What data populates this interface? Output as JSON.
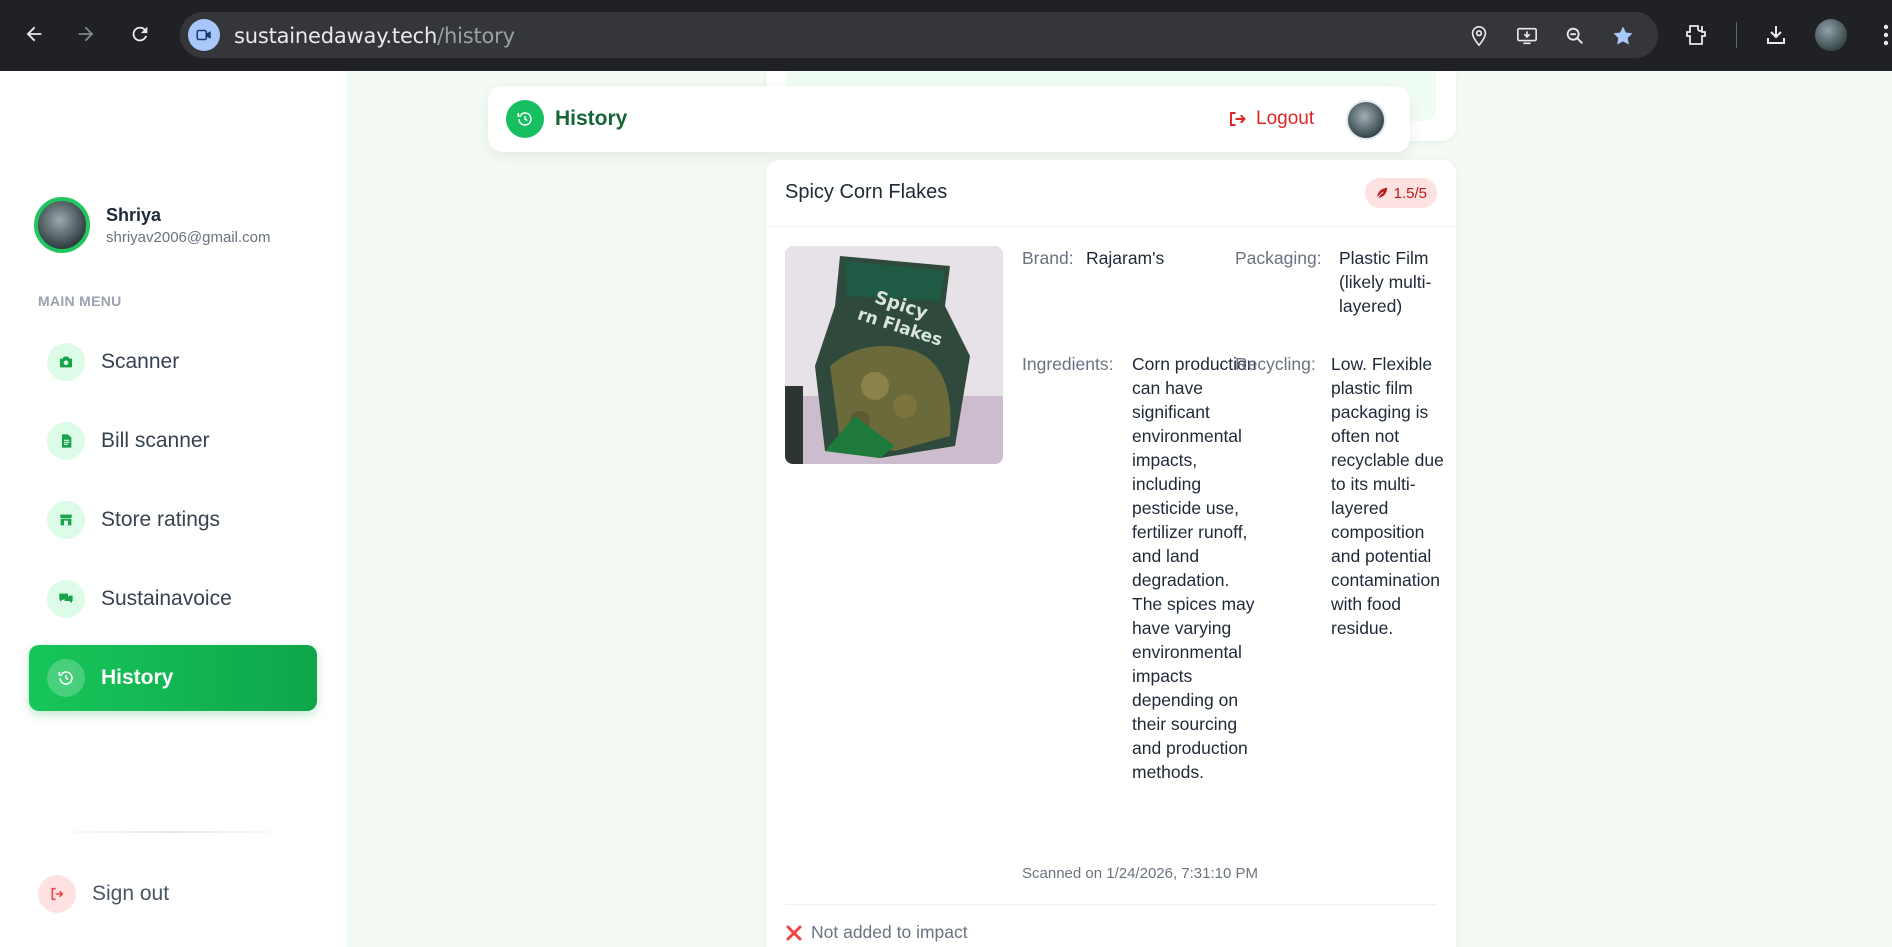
{
  "browser": {
    "url_host": "sustainedaway.tech",
    "url_path": "/history"
  },
  "sidebar": {
    "user": {
      "name": "Shriya",
      "email": "shriyav2006@gmail.com"
    },
    "menu_heading": "MAIN MENU",
    "items": [
      {
        "label": "Scanner",
        "icon": "camera-icon"
      },
      {
        "label": "Bill scanner",
        "icon": "receipt-icon"
      },
      {
        "label": "Store ratings",
        "icon": "store-icon"
      },
      {
        "label": "Sustainavoice",
        "icon": "chat-icon"
      },
      {
        "label": "History",
        "icon": "history-icon",
        "active": true
      }
    ],
    "sign_out": "Sign out"
  },
  "header": {
    "title": "History",
    "logout": "Logout"
  },
  "product": {
    "title": "Spicy Corn Flakes",
    "score": "1.5/5",
    "brand_label": "Brand:",
    "brand": "Rajaram's",
    "packaging_label": "Packaging:",
    "packaging": "Plastic Film (likely multi-layered)",
    "ingredients_label": "Ingredients:",
    "ingredients": "Corn production can have significant environmental impacts, including pesticide use, fertilizer runoff, and land degradation. The spices may have varying environmental impacts depending on their sourcing and production methods.",
    "recycling_label": "Recycling:",
    "recycling": "Low. Flexible plastic film packaging is often not recyclable due to its multi-layered composition and potential contamination with food residue.",
    "scanned": "Scanned on 1/24/2026, 7:31:10 PM",
    "impact_status": "Not added to impact",
    "image_text": "Spicy Corn Flakes"
  },
  "colors": {
    "accent": "#16c060",
    "accent_dark": "#166534",
    "danger": "#dc2626",
    "page_bg": "#f3fbf4"
  }
}
